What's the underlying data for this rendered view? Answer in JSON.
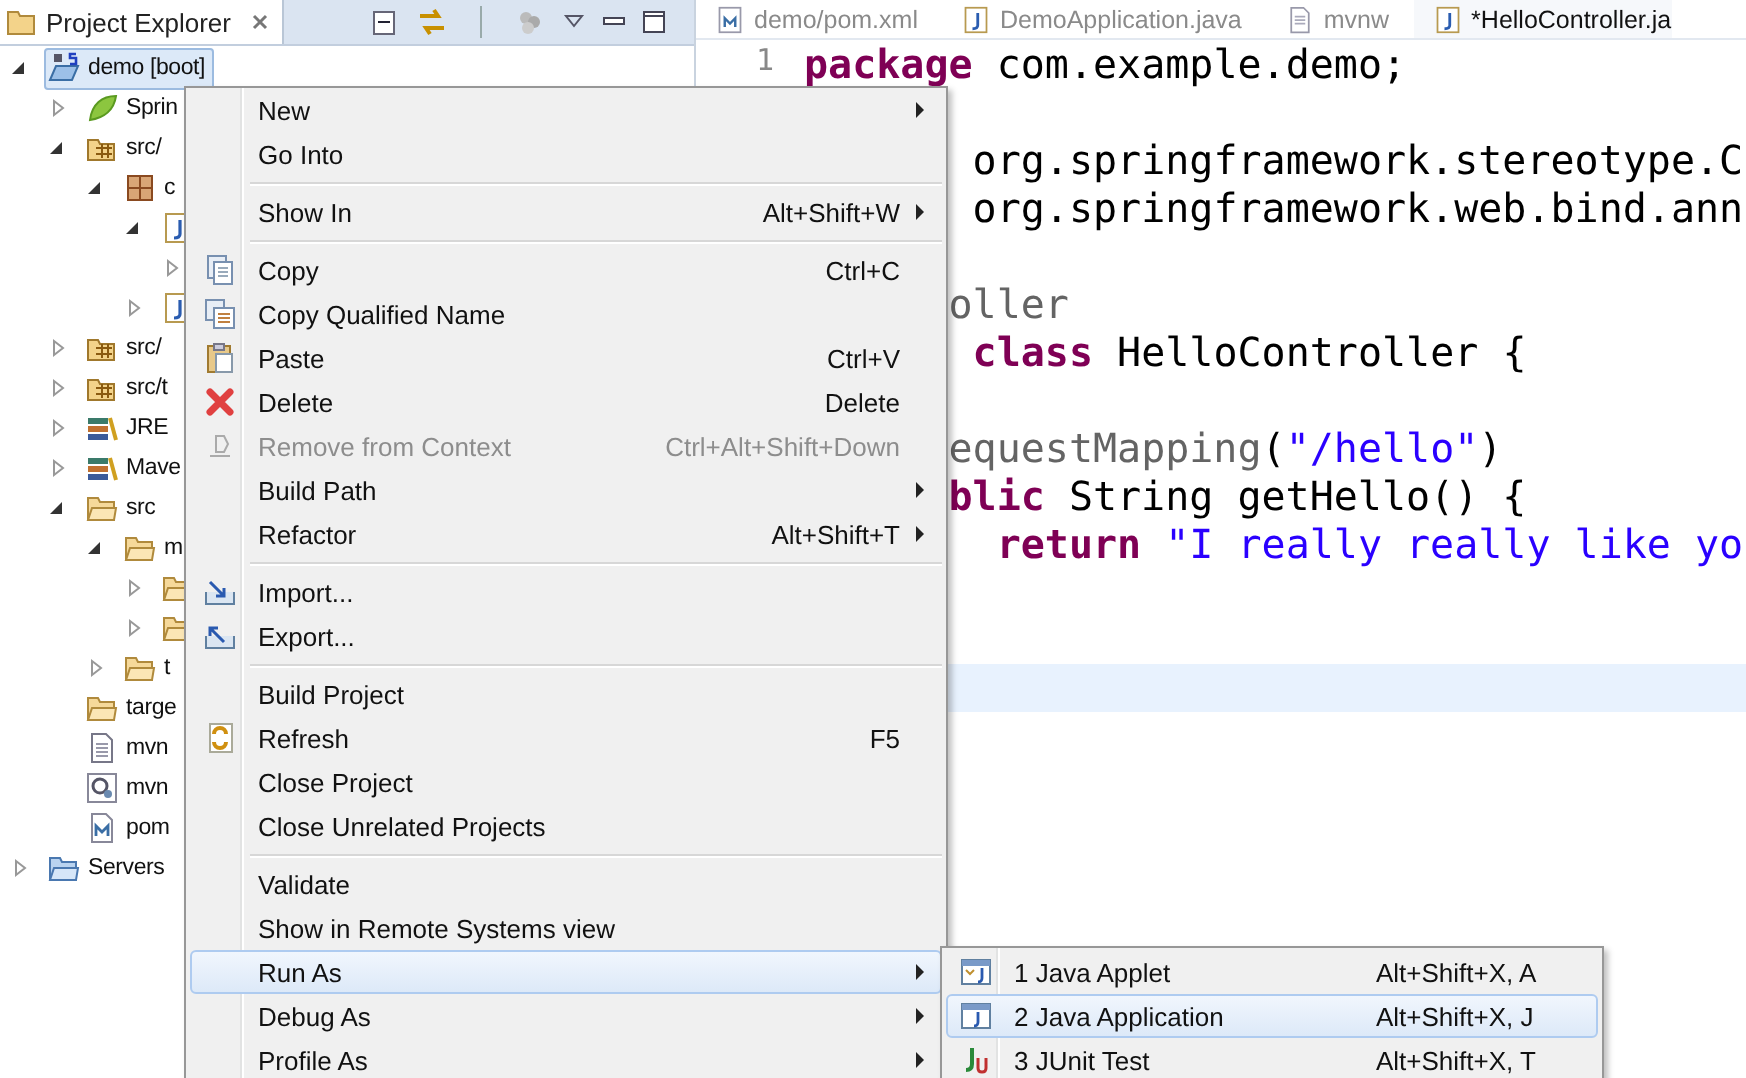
{
  "explorer": {
    "title": "Project Explorer",
    "tree": [
      {
        "label": "demo [boot]",
        "kind": "project",
        "expanded": true,
        "selected": true,
        "children": [
          {
            "label": "Sprin",
            "kind": "spring",
            "expanded": false,
            "selected": false
          },
          {
            "label": "src/",
            "kind": "source-folder",
            "expanded": true,
            "selected": false,
            "children": [
              {
                "label": "c",
                "kind": "package",
                "expanded": true,
                "selected": false,
                "children": [
                  {
                    "kind": "java-file",
                    "expanded": true,
                    "selected": false,
                    "children": [
                      {
                        "expanded": false
                      }
                    ]
                  },
                  {
                    "kind": "java-file",
                    "expanded": false,
                    "selected": false
                  }
                ]
              }
            ]
          },
          {
            "label": "src/",
            "kind": "source-folder",
            "expanded": false,
            "selected": false
          },
          {
            "label": "src/t",
            "kind": "source-folder",
            "expanded": false,
            "selected": false
          },
          {
            "label": "JRE",
            "kind": "library",
            "expanded": false,
            "selected": false
          },
          {
            "label": "Mave",
            "kind": "library",
            "expanded": false,
            "selected": false
          },
          {
            "label": "src",
            "kind": "folder",
            "expanded": true,
            "selected": false,
            "children": [
              {
                "label": "m",
                "kind": "folder",
                "expanded": true,
                "selected": false,
                "children": [
                  {
                    "kind": "folder",
                    "expanded": false,
                    "selected": false
                  },
                  {
                    "kind": "folder",
                    "expanded": false,
                    "selected": false
                  }
                ]
              },
              {
                "label": "t",
                "kind": "folder",
                "expanded": false,
                "selected": false
              }
            ]
          },
          {
            "label": "targe",
            "kind": "folder",
            "selected": false
          },
          {
            "label": "mvn",
            "kind": "text-file",
            "selected": false
          },
          {
            "label": "mvn",
            "kind": "script-file",
            "selected": false
          },
          {
            "label": "pom",
            "kind": "maven-file",
            "selected": false
          }
        ]
      },
      {
        "label": "Servers",
        "kind": "servers",
        "expanded": false,
        "selected": false
      }
    ]
  },
  "editor": {
    "tabs": [
      {
        "label": "demo/pom.xml",
        "kind": "maven",
        "selected": false
      },
      {
        "label": "DemoApplication.java",
        "kind": "java",
        "selected": false
      },
      {
        "label": "mvnw",
        "kind": "text",
        "selected": false
      },
      {
        "label": "*HelloController.ja",
        "kind": "java",
        "selected": true
      }
    ],
    "lines": [
      {
        "number": "1",
        "current": false,
        "segments": [
          {
            "kind": "keyword",
            "text": "package"
          },
          {
            "kind": "plain",
            "text": " com.example.demo;"
          }
        ]
      },
      {
        "current": false
      },
      {
        "current": false,
        "segments": [
          {
            "kind": "plain",
            "text": "       org.springframework.stereotype.C"
          }
        ]
      },
      {
        "current": false,
        "segments": [
          {
            "kind": "plain",
            "text": "       org.springframework.web.bind.ann"
          }
        ]
      },
      {
        "current": false
      },
      {
        "current": false,
        "segments": [
          {
            "kind": "annotation",
            "text": "      oller"
          }
        ]
      },
      {
        "current": false,
        "segments": [
          {
            "kind": "keyword",
            "text": "       class"
          },
          {
            "kind": "plain",
            "text": " HelloController {"
          }
        ]
      },
      {
        "current": false
      },
      {
        "current": false,
        "segments": [
          {
            "kind": "annotation",
            "text": "      equestMapping"
          },
          {
            "kind": "plain",
            "text": "("
          },
          {
            "kind": "string",
            "text": "\"/hello\""
          },
          {
            "kind": "plain",
            "text": ")"
          }
        ]
      },
      {
        "current": false,
        "segments": [
          {
            "kind": "keyword",
            "text": "      blic"
          },
          {
            "kind": "plain",
            "text": " String getHello() {"
          }
        ]
      },
      {
        "current": false,
        "segments": [
          {
            "kind": "keyword",
            "text": "        return"
          },
          {
            "kind": "string",
            "text": " \"I really really like yo"
          }
        ]
      },
      {
        "current": false
      },
      {
        "current": false
      },
      {
        "current": true
      }
    ]
  },
  "context_menu": {
    "items": [
      {
        "kind": "plain",
        "label": "New",
        "submenu": true,
        "selected": false
      },
      {
        "kind": "plain",
        "label": "Go Into",
        "selected": false
      },
      {
        "kind": "separator"
      },
      {
        "kind": "plain",
        "label": "Show In",
        "shortcut": "Alt+Shift+W",
        "submenu": true,
        "selected": false
      },
      {
        "kind": "separator"
      },
      {
        "kind": "copy",
        "label": "Copy",
        "shortcut": "Ctrl+C",
        "selected": false
      },
      {
        "kind": "copy-qualified",
        "label": "Copy Qualified Name",
        "selected": false
      },
      {
        "kind": "paste",
        "label": "Paste",
        "shortcut": "Ctrl+V",
        "selected": false
      },
      {
        "kind": "delete",
        "label": "Delete",
        "shortcut": "Delete",
        "selected": false
      },
      {
        "kind": "remove",
        "label": "Remove from Context",
        "shortcut": "Ctrl+Alt+Shift+Down",
        "disabled": true,
        "selected": false
      },
      {
        "kind": "plain",
        "label": "Build Path",
        "submenu": true,
        "selected": false
      },
      {
        "kind": "plain",
        "label": "Refactor",
        "shortcut": "Alt+Shift+T",
        "submenu": true,
        "selected": false
      },
      {
        "kind": "separator"
      },
      {
        "kind": "import",
        "label": "Import...",
        "selected": false
      },
      {
        "kind": "export",
        "label": "Export...",
        "selected": false
      },
      {
        "kind": "separator"
      },
      {
        "kind": "plain",
        "label": "Build Project",
        "selected": false
      },
      {
        "kind": "refresh",
        "label": "Refresh",
        "shortcut": "F5",
        "selected": false
      },
      {
        "kind": "plain",
        "label": "Close Project",
        "selected": false
      },
      {
        "kind": "plain",
        "label": "Close Unrelated Projects",
        "selected": false
      },
      {
        "kind": "separator"
      },
      {
        "kind": "plain",
        "label": "Validate",
        "selected": false
      },
      {
        "kind": "plain",
        "label": "Show in Remote Systems view",
        "selected": false
      },
      {
        "kind": "plain",
        "label": "Run As",
        "submenu": true,
        "selected": true
      },
      {
        "kind": "plain",
        "label": "Debug As",
        "submenu": true,
        "selected": false
      },
      {
        "kind": "plain",
        "label": "Profile As",
        "submenu": true,
        "selected": false
      }
    ]
  },
  "run_as_menu": {
    "items": [
      {
        "kind": "applet",
        "label": "1 Java Applet",
        "shortcut": "Alt+Shift+X, A",
        "selected": false
      },
      {
        "kind": "application",
        "label": "2 Java Application",
        "shortcut": "Alt+Shift+X, J",
        "selected": true
      },
      {
        "kind": "junit",
        "label": "3 JUnit Test",
        "shortcut": "Alt+Shift+X, T",
        "selected": false
      }
    ]
  }
}
